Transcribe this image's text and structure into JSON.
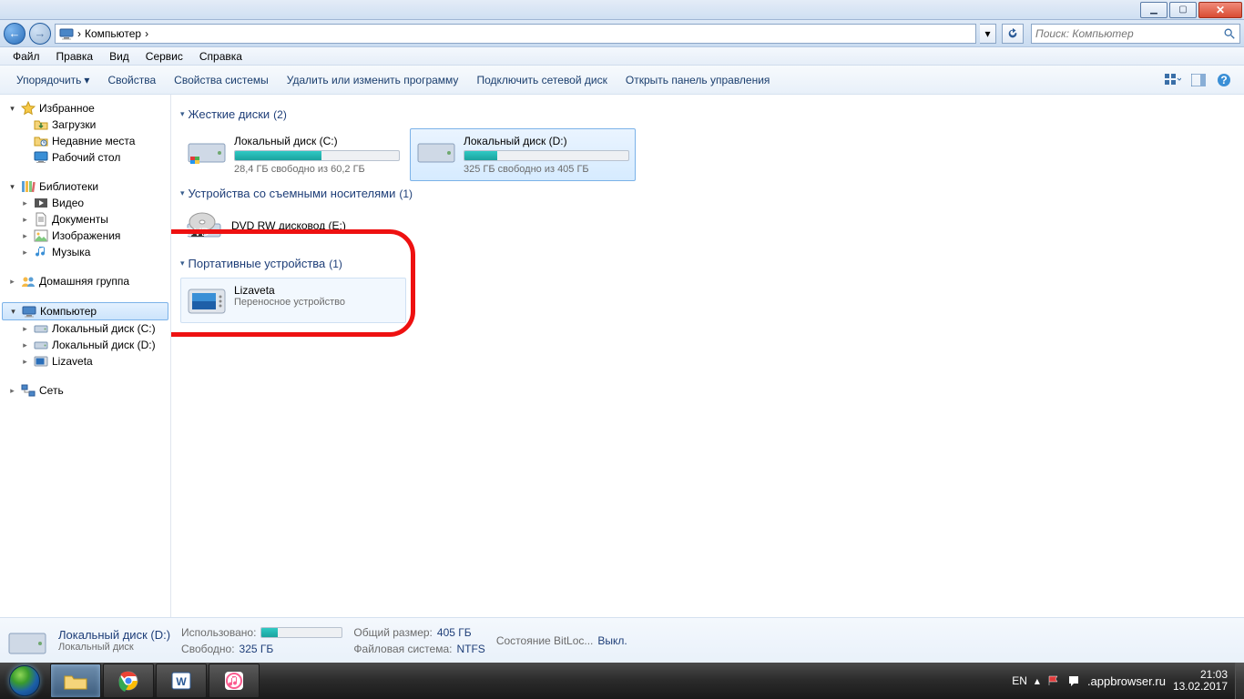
{
  "breadcrumb": {
    "root": "Компьютер",
    "sep": "›"
  },
  "search": {
    "placeholder": "Поиск: Компьютер"
  },
  "menu": {
    "file": "Файл",
    "edit": "Правка",
    "view": "Вид",
    "service": "Сервис",
    "help": "Справка"
  },
  "toolbar": {
    "organize": "Упорядочить",
    "properties": "Свойства",
    "sysprops": "Свойства системы",
    "uninstall": "Удалить или изменить программу",
    "netdrive": "Подключить сетевой диск",
    "controlpanel": "Открыть панель управления"
  },
  "sidebar": {
    "favorites": "Избранное",
    "downloads": "Загрузки",
    "recent": "Недавние места",
    "desktop": "Рабочий стол",
    "libraries": "Библиотеки",
    "video": "Видео",
    "documents": "Документы",
    "pictures": "Изображения",
    "music": "Музыка",
    "homegroup": "Домашняя группа",
    "computer": "Компьютер",
    "localC": "Локальный диск (C:)",
    "localD": "Локальный диск (D:)",
    "lizaveta": "Lizaveta",
    "network": "Сеть"
  },
  "groups": {
    "hdd": {
      "title": "Жесткие диски",
      "count": "(2)"
    },
    "removable": {
      "title": "Устройства со съемными носителями",
      "count": "(1)"
    },
    "portable": {
      "title": "Портативные устройства",
      "count": "(1)"
    }
  },
  "drives": {
    "c": {
      "name": "Локальный диск (C:)",
      "free": "28,4 ГБ свободно из 60,2 ГБ",
      "fillpct": 53
    },
    "d": {
      "name": "Локальный диск (D:)",
      "free": "325 ГБ свободно из 405 ГБ",
      "fillpct": 20
    }
  },
  "dvd": {
    "name": "DVD RW дисковод (E:)"
  },
  "portable": {
    "name": "Lizaveta",
    "type": "Переносное устройство"
  },
  "details": {
    "title": "Локальный диск (D:)",
    "subtitle": "Локальный диск",
    "used_k": "Использовано:",
    "free_k": "Свободно:",
    "free_v": "325 ГБ",
    "total_k": "Общий размер:",
    "total_v": "405 ГБ",
    "fs_k": "Файловая система:",
    "fs_v": "NTFS",
    "bitlocker_k": "Состояние BitLoc...",
    "bitlocker_v": "Выкл."
  },
  "tray": {
    "lang": "EN",
    "time": "21:03",
    "date": "13.02.2017"
  },
  "watermark": ".appbrowser.ru"
}
